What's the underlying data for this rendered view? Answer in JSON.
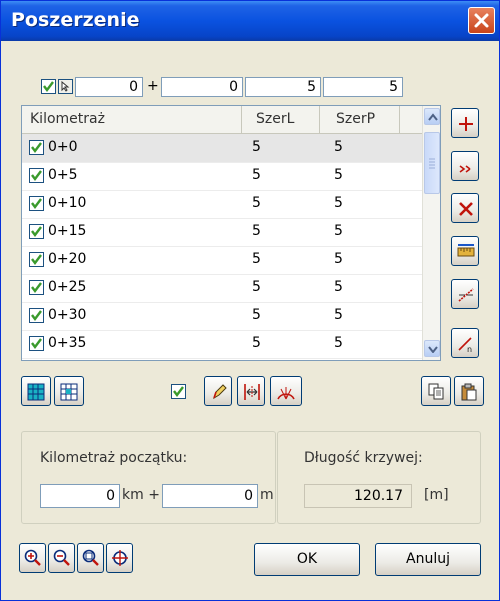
{
  "window": {
    "title": "Poszerzenie"
  },
  "top_inputs": {
    "km_value": "0",
    "plus_sign": "+",
    "m_value": "0",
    "szer_l": "5",
    "szer_p": "5"
  },
  "table": {
    "headers": {
      "kilometraz": "Kilometraż",
      "szer_l": "SzerL",
      "szer_p": "SzerP"
    },
    "rows": [
      {
        "km": "0+0",
        "szer_l": "5",
        "szer_p": "5",
        "checked": true
      },
      {
        "km": "0+5",
        "szer_l": "5",
        "szer_p": "5",
        "checked": true
      },
      {
        "km": "0+10",
        "szer_l": "5",
        "szer_p": "5",
        "checked": true
      },
      {
        "km": "0+15",
        "szer_l": "5",
        "szer_p": "5",
        "checked": true
      },
      {
        "km": "0+20",
        "szer_l": "5",
        "szer_p": "5",
        "checked": true
      },
      {
        "km": "0+25",
        "szer_l": "5",
        "szer_p": "5",
        "checked": true
      },
      {
        "km": "0+30",
        "szer_l": "5",
        "szer_p": "5",
        "checked": true
      },
      {
        "km": "0+35",
        "szer_l": "5",
        "szer_p": "5",
        "checked": true
      }
    ]
  },
  "start": {
    "label": "Kilometraż początku:",
    "km_value": "0",
    "km_unit": "km +",
    "m_value": "0",
    "m_unit": "m"
  },
  "length": {
    "label": "Długość krzywej:",
    "value": "120.17",
    "unit": "[m]"
  },
  "buttons": {
    "ok": "OK",
    "cancel": "Anuluj"
  },
  "colors": {
    "title_bar": "#0a52e0",
    "check": "#3a9a2c",
    "close": "#d9572b",
    "tool_red": "#c0140c"
  }
}
